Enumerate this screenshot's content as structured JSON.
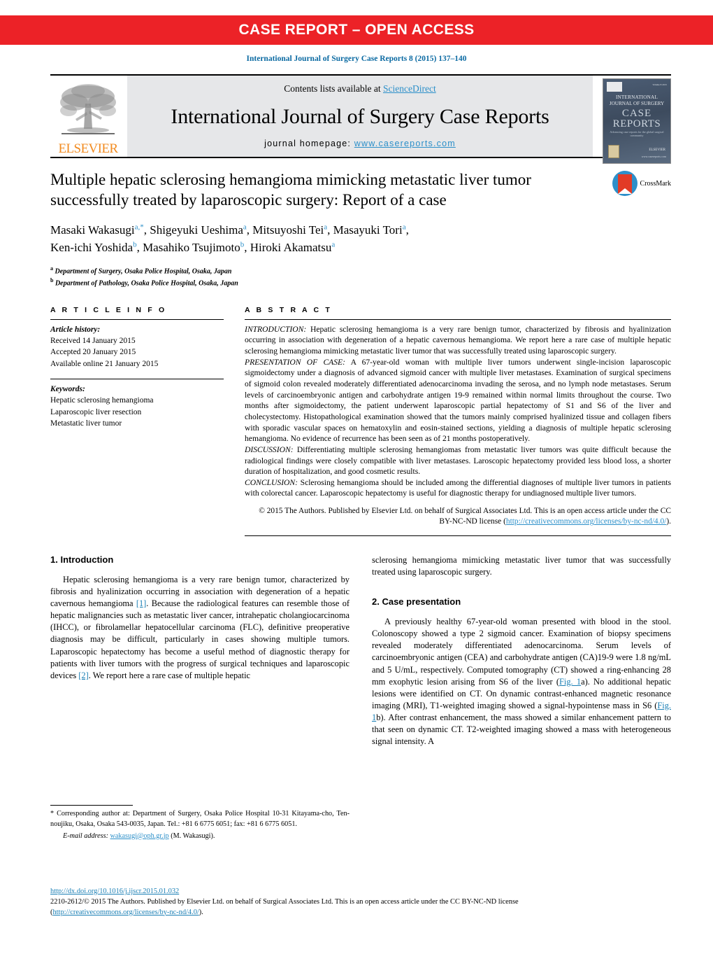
{
  "banner": {
    "label": "CASE REPORT – OPEN ACCESS"
  },
  "running_head": "International Journal of Surgery Case Reports 8 (2015) 137–140",
  "masthead": {
    "contents_prefix": "Contents lists available at ",
    "sciencedirect": "ScienceDirect",
    "journal_title": "International Journal of Surgery Case Reports",
    "homepage_prefix": "journal homepage: ",
    "homepage_url": "www.casereports.com",
    "publisher_word": "ELSEVIER",
    "cover": {
      "line1": "INTERNATIONAL",
      "line2": "JOURNAL OF SURGERY",
      "line3": "CASE",
      "line4": "REPORTS",
      "line5": "Advancing case reports for the global surgical community",
      "corner": "Volume 8 2015",
      "elsevier": "ELSEVIER",
      "url": "www.casereports.com"
    }
  },
  "article": {
    "title": "Multiple hepatic sclerosing hemangioma mimicking metastatic liver tumor successfully treated by laparoscopic surgery: Report of a case",
    "crossmark_label": "CrossMark",
    "authors_line1": "Masaki Wakasugi",
    "authors": "Masaki Wakasugi a,*, Shigeyuki Ueshima a, Mitsuyoshi Tei a, Masayuki Tori a, Ken-ichi Yoshida b, Masahiko Tsujimoto b, Hiroki Akamatsu a",
    "affiliations": [
      {
        "mark": "a",
        "text": "Department of Surgery, Osaka Police Hospital, Osaka, Japan"
      },
      {
        "mark": "b",
        "text": "Department of Pathology, Osaka Police Hospital, Osaka, Japan"
      }
    ]
  },
  "article_info": {
    "heading": "A R T I C L E   I N F O",
    "history_label": "Article history:",
    "received": "Received 14 January 2015",
    "accepted": "Accepted 20 January 2015",
    "available": "Available online 21 January 2015",
    "keywords_label": "Keywords:",
    "keywords": [
      "Hepatic sclerosing hemangioma",
      "Laparoscopic liver resection",
      "Metastatic liver tumor"
    ]
  },
  "abstract": {
    "heading": "A B S T R A C T",
    "introduction_label": "INTRODUCTION:",
    "introduction": " Hepatic sclerosing hemangioma is a very rare benign tumor, characterized by fibrosis and hyalinization occurring in association with degeneration of a hepatic cavernous hemangioma. We report here a rare case of multiple hepatic sclerosing hemangioma mimicking metastatic liver tumor that was successfully treated using laparoscopic surgery.",
    "presentation_label": "PRESENTATION OF CASE:",
    "presentation": " A 67-year-old woman with multiple liver tumors underwent single-incision laparoscopic sigmoidectomy under a diagnosis of advanced sigmoid cancer with multiple liver metastases. Examination of surgical specimens of sigmoid colon revealed moderately differentiated adenocarcinoma invading the serosa, and no lymph node metastases. Serum levels of carcinoembryonic antigen and carbohydrate antigen 19-9 remained within normal limits throughout the course. Two months after sigmoidectomy, the patient underwent laparoscopic partial hepatectomy of S1 and S6 of the liver and cholecystectomy. Histopathological examination showed that the tumors mainly comprised hyalinized tissue and collagen fibers with sporadic vascular spaces on hematoxylin and eosin-stained sections, yielding a diagnosis of multiple hepatic sclerosing hemangioma. No evidence of recurrence has been seen as of 21 months postoperatively.",
    "discussion_label": "DISCUSSION:",
    "discussion": " Differentiating multiple sclerosing hemangiomas from metastatic liver tumors was quite difficult because the radiological findings were closely compatible with liver metastases. Laroscopic hepatectomy provided less blood loss, a shorter duration of hospitalization, and good cosmetic results.",
    "conclusion_label": "CONCLUSION:",
    "conclusion": " Sclerosing hemangioma should be included among the differential diagnoses of multiple liver tumors in patients with colorectal cancer. Laparoscopic hepatectomy is useful for diagnostic therapy for undiagnosed multiple liver tumors.",
    "copyright_part1": "© 2015 The Authors. Published by Elsevier Ltd. on behalf of Surgical Associates Ltd. This is an open access article under the CC BY-NC-ND license (",
    "copyright_link": "http://creativecommons.org/licenses/by-nc-nd/4.0/",
    "copyright_part2": ")."
  },
  "sections": {
    "intro_heading": "1.  Introduction",
    "intro_p1_a": "Hepatic sclerosing hemangioma is a very rare benign tumor, characterized by fibrosis and hyalinization occurring in association with degeneration of a hepatic cavernous hemangioma ",
    "intro_ref1": "[1]",
    "intro_p1_b": ". Because the radiological features can resemble those of hepatic malignancies such as metastatic liver cancer, intrahepatic cholangiocarcinoma (IHCC), or fibrolamellar hepatocellular carcinoma (FLC), definitive preoperative diagnosis may be difficult, particularly in cases showing multiple tumors. Laparoscopic hepatectomy has become a useful method of diagnostic therapy for patients with liver tumors with the progress of surgical techniques and laparoscopic devices ",
    "intro_ref2": "[2]",
    "intro_p1_c": ". We report here a rare case of multiple hepatic",
    "intro_cont": "sclerosing hemangioma mimicking metastatic liver tumor that was successfully treated using laparoscopic surgery.",
    "case_heading": "2.  Case presentation",
    "case_p1_a": "A previously healthy 67-year-old woman presented with blood in the stool. Colonoscopy showed a type 2 sigmoid cancer. Examination of biopsy specimens revealed moderately differentiated adenocarcinoma. Serum levels of carcinoembryonic antigen (CEA) and carbohydrate antigen (CA)19-9 were 1.8 ng/mL and 5 U/mL, respectively. Computed tomography (CT) showed a ring-enhancing 28 mm exophytic lesion arising from S6 of the liver (",
    "case_fig1a": "Fig. 1",
    "case_p1_b": "a). No additional hepatic lesions were identified on CT. On dynamic contrast-enhanced magnetic resonance imaging (MRI), T1-weighted imaging showed a signal-hypointense mass in S6 (",
    "case_fig1b": "Fig. 1",
    "case_p1_c": "b). After contrast enhancement, the mass showed a similar enhancement pattern to that seen on dynamic CT. T2-weighted imaging showed a mass with heterogeneous signal intensity. A"
  },
  "footnotes": {
    "corresponding": "* Corresponding author at: Department of Surgery, Osaka Police Hospital 10-31 Kitayama-cho, Ten-noujiku, Osaka, Osaka 543-0035, Japan. Tel.: +81 6 6775 6051; fax: +81 6 6775 6051.",
    "email_label": "E-mail address:",
    "email": "wakasugi@oph.gr.jp",
    "email_suffix": "(M. Wakasugi)."
  },
  "doi_block": {
    "doi_url": "http://dx.doi.org/10.1016/j.ijscr.2015.01.032",
    "issn_line_a": "2210-2612/© 2015 The Authors. Published by Elsevier Ltd. on behalf of Surgical Associates Ltd. This is an open access article under the CC BY-NC-ND license",
    "issn_open": "(",
    "license_url": "http://creativecommons.org/licenses/by-nc-nd/4.0/",
    "issn_close": ")."
  },
  "colors": {
    "banner_red": "#ec2227",
    "link_blue": "#2b8fc9",
    "elsevier_orange": "#f28b20",
    "masthead_grey": "#e6e7e9"
  }
}
